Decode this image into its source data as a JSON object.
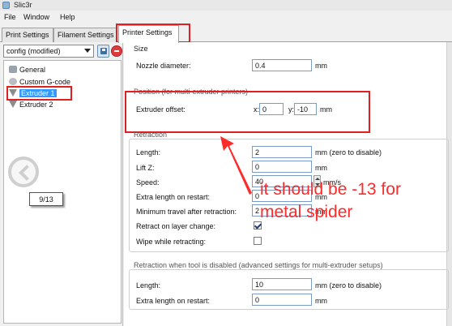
{
  "window": {
    "title": "Slic3r",
    "accent": "#3399ff"
  },
  "menu": {
    "items": [
      "File",
      "Window",
      "Help"
    ]
  },
  "tabs": [
    {
      "label": "Print Settings",
      "active": false
    },
    {
      "label": "Filament Settings",
      "active": false
    },
    {
      "label": "Printer Settings",
      "active": true
    }
  ],
  "sidebar": {
    "preset": "config (modified)",
    "save_icon": "disk-icon",
    "delete_icon": "minus-circle-icon",
    "items": [
      {
        "label": "General",
        "icon": "printer-icon"
      },
      {
        "label": "Custom G-code",
        "icon": "gear-icon"
      },
      {
        "label": "Extruder 1",
        "icon": "funnel-icon",
        "selected": true
      },
      {
        "label": "Extruder 2",
        "icon": "funnel-icon"
      }
    ],
    "pager": "9/13"
  },
  "size": {
    "title": "Size",
    "nozzle_label": "Nozzle diameter:",
    "nozzle_value": "0.4",
    "nozzle_unit": "mm"
  },
  "position": {
    "title": "Position (for multi-extruder printers)",
    "offset_label": "Extruder offset:",
    "x_label": "x:",
    "x_value": "0",
    "y_label": "y:",
    "y_value": "-10",
    "unit": "mm"
  },
  "retraction": {
    "title": "Retraction",
    "length_label": "Length:",
    "length_value": "2",
    "length_unit": "mm (zero to disable)",
    "liftz_label": "Lift Z:",
    "liftz_value": "0",
    "liftz_unit": "mm",
    "speed_label": "Speed:",
    "speed_value": "40",
    "speed_unit": "mm/s",
    "extra_label": "Extra length on restart:",
    "extra_value": "0",
    "extra_unit": "mm",
    "mintravel_label": "Minimum travel after retraction:",
    "mintravel_value": "2",
    "mintravel_unit": "mm",
    "layerchange_label": "Retract on layer change:",
    "layerchange_checked": true,
    "wipe_label": "Wipe while retracting:",
    "wipe_checked": false
  },
  "retraction_disabled": {
    "title": "Retraction when tool is disabled (advanced settings for multi-extruder setups)",
    "length_label": "Length:",
    "length_value": "10",
    "length_unit": "mm (zero to disable)",
    "extra_label": "Extra length on restart:",
    "extra_value": "0",
    "extra_unit": "mm"
  },
  "annotation": {
    "line1": "it should be -13 for",
    "line2": "metal spider",
    "color": "#ff2a2a"
  }
}
